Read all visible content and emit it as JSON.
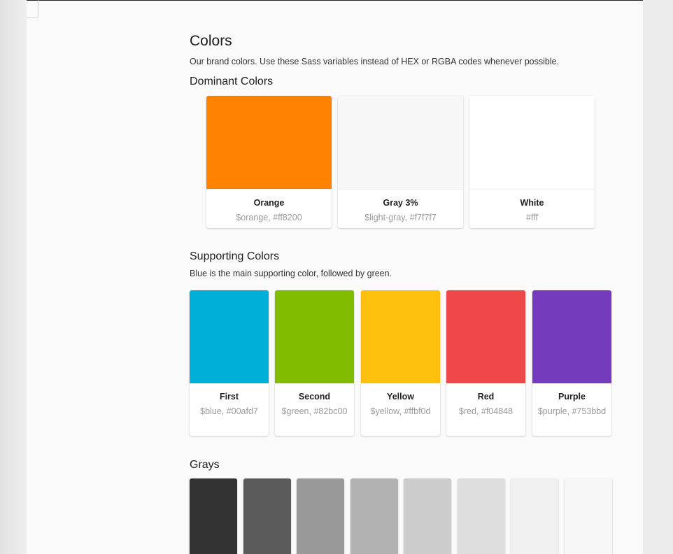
{
  "page": {
    "title": "Colors",
    "intro": "Our brand colors. Use these Sass variables instead of HEX or RGBA codes whenever possible."
  },
  "dominant": {
    "heading": "Dominant Colors",
    "cards": [
      {
        "name": "Orange",
        "variable": "$orange, #ff8200",
        "color": "#ff8200"
      },
      {
        "name": "Gray 3%",
        "variable": "$light-gray, #f7f7f7",
        "color": "#f7f7f7"
      },
      {
        "name": "White",
        "variable": "#fff",
        "color": "#ffffff"
      }
    ]
  },
  "supporting": {
    "heading": "Supporting Colors",
    "description": "Blue is the main supporting color, followed by green.",
    "cards": [
      {
        "name": "First",
        "variable": "$blue, #00afd7",
        "color": "#00afd7"
      },
      {
        "name": "Second",
        "variable": "$green, #82bc00",
        "color": "#82bc00"
      },
      {
        "name": "Yellow",
        "variable": "$yellow, #ffbf0d",
        "color": "#ffbf0d"
      },
      {
        "name": "Red",
        "variable": "$red, #f04848",
        "color": "#f04848"
      },
      {
        "name": "Purple",
        "variable": "$purple, #753bbd",
        "color": "#753bbd"
      }
    ]
  },
  "grays": {
    "heading": "Grays",
    "swatches": [
      "#333333",
      "#5a5a5a",
      "#999999",
      "#b2b2b2",
      "#cccccc",
      "#dedede",
      "#f0f0f0",
      "#f7f7f7"
    ]
  }
}
